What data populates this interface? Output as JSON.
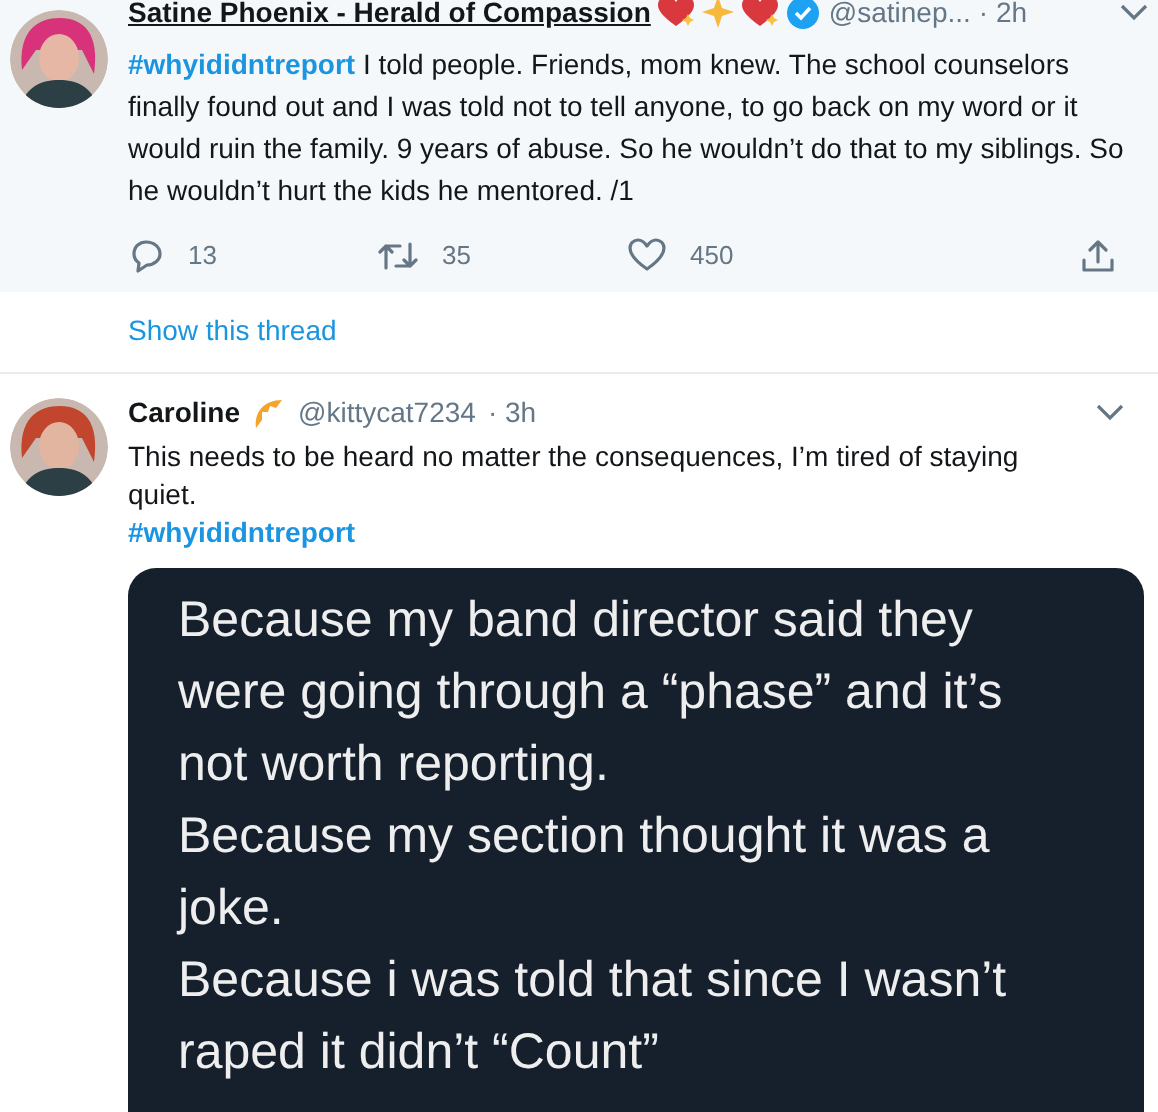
{
  "tweets": [
    {
      "author": "Satine Phoenix - Herald of Compassion",
      "handle": "@satinep...",
      "time": "· 2h",
      "hashtag": "#whyididntreport",
      "text": "I told people. Friends, mom knew. The school counselors finally found out and I was told not to tell anyone, to go back on my word or it would ruin the family. 9 years of abuse. So he wouldn’t do that to my siblings. So he wouldn’t hurt the kids he mentored. /1",
      "verified": true,
      "actions": [
        {
          "kind": "reply",
          "count": "13"
        },
        {
          "kind": "retweet",
          "count": "35"
        },
        {
          "kind": "like",
          "count": "450"
        },
        {
          "kind": "share"
        }
      ],
      "show_thread": "Show this thread"
    },
    {
      "author": "Caroline",
      "handle": "@kittycat7234",
      "time": "· 3h",
      "text": "This needs to be heard no matter the consequences, I’m tired of staying quiet.",
      "hashtag_after": "#whyididntreport",
      "image_lines": [
        "Because my band director said they were going through a “phase” and it’s not worth reporting.",
        "Because my section thought it was a joke.",
        "Because i was told that since I wasn’t raped it didn’t “Count”"
      ]
    }
  ]
}
